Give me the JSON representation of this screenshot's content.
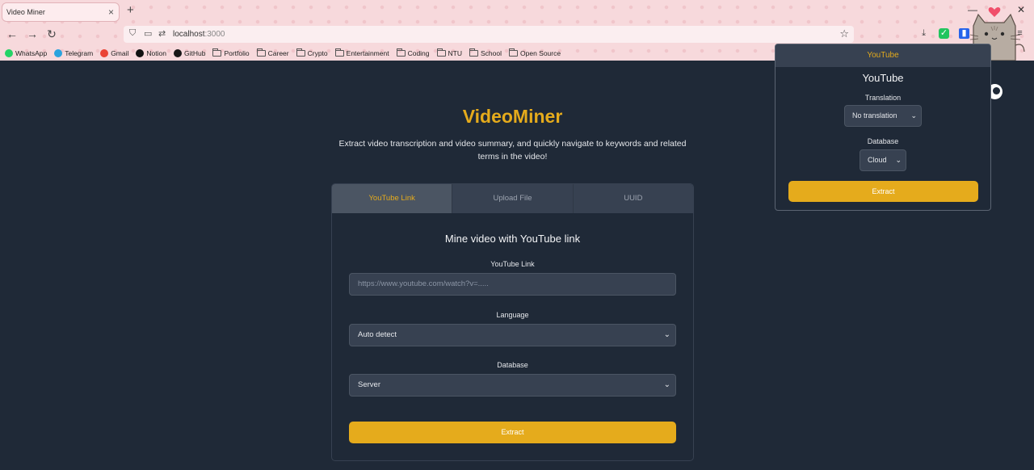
{
  "browser": {
    "tab_title": "Video Miner",
    "tab_close": "×",
    "new_tab": "+",
    "minimize": "—",
    "close_window": "✕",
    "url_host": "localhost",
    "url_port": ":3000",
    "bookmarks": [
      {
        "label": "WhatsApp",
        "icon": "whatsapp-icon",
        "color": "#25d366"
      },
      {
        "label": "Telegram",
        "icon": "telegram-icon",
        "color": "#2aa3de"
      },
      {
        "label": "Gmail",
        "icon": "gmail-icon",
        "color": "#ea4335"
      },
      {
        "label": "Notion",
        "icon": "notion-icon",
        "color": "#111111"
      },
      {
        "label": "GitHub",
        "icon": "github-icon",
        "color": "#181717"
      },
      {
        "label": "Portfolio",
        "icon": "folder-icon"
      },
      {
        "label": "Career",
        "icon": "folder-icon"
      },
      {
        "label": "Crypto",
        "icon": "folder-icon"
      },
      {
        "label": "Entertainment",
        "icon": "folder-icon"
      },
      {
        "label": "Coding",
        "icon": "folder-icon"
      },
      {
        "label": "NTU",
        "icon": "folder-icon"
      },
      {
        "label": "School",
        "icon": "folder-icon"
      },
      {
        "label": "Open Source",
        "icon": "folder-icon"
      }
    ]
  },
  "page": {
    "title": "VideoMiner",
    "subtitle": "Extract video transcription and video summary, and quickly navigate to keywords and related terms in the video!",
    "tabs": [
      "YouTube Link",
      "Upload File",
      "UUID"
    ],
    "active_tab": 0,
    "card_title": "Mine video with YouTube link",
    "youtube_label": "YouTube Link",
    "youtube_placeholder": "https://www.youtube.com/watch?v=.....",
    "language_label": "Language",
    "language_value": "Auto detect",
    "database_label": "Database",
    "database_value": "Server",
    "extract_button": "Extract"
  },
  "popup": {
    "header": "YouTube",
    "title": "YouTube",
    "translation_label": "Translation",
    "translation_value": "No translation",
    "database_label": "Database",
    "database_value": "Cloud",
    "extract_button": "Extract"
  },
  "colors": {
    "accent": "#e5ab1c",
    "background": "#1f2937",
    "panel": "#374151",
    "chrome_pink": "#f7d9dc"
  }
}
